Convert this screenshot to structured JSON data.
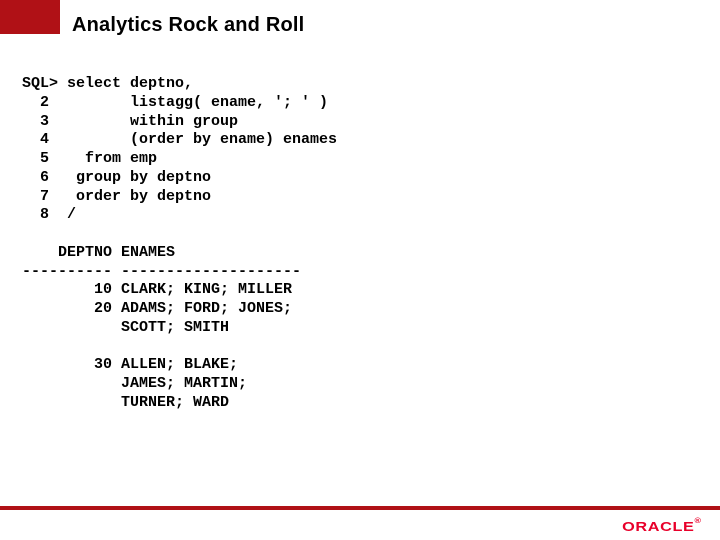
{
  "slide": {
    "title": "Analytics Rock and Roll"
  },
  "code": {
    "lines": [
      "SQL> select deptno,",
      "  2         listagg( ename, '; ' )",
      "  3         within group",
      "  4         (order by ename) enames",
      "  5    from emp",
      "  6   group by deptno",
      "  7   order by deptno",
      "  8  /",
      "",
      "    DEPTNO ENAMES",
      "---------- --------------------",
      "        10 CLARK; KING; MILLER",
      "        20 ADAMS; FORD; JONES;",
      "           SCOTT; SMITH",
      "",
      "        30 ALLEN; BLAKE;",
      "           JAMES; MARTIN;",
      "           TURNER; WARD"
    ]
  },
  "branding": {
    "logo_text": "ORACLE",
    "accent_color": "#b01116"
  }
}
